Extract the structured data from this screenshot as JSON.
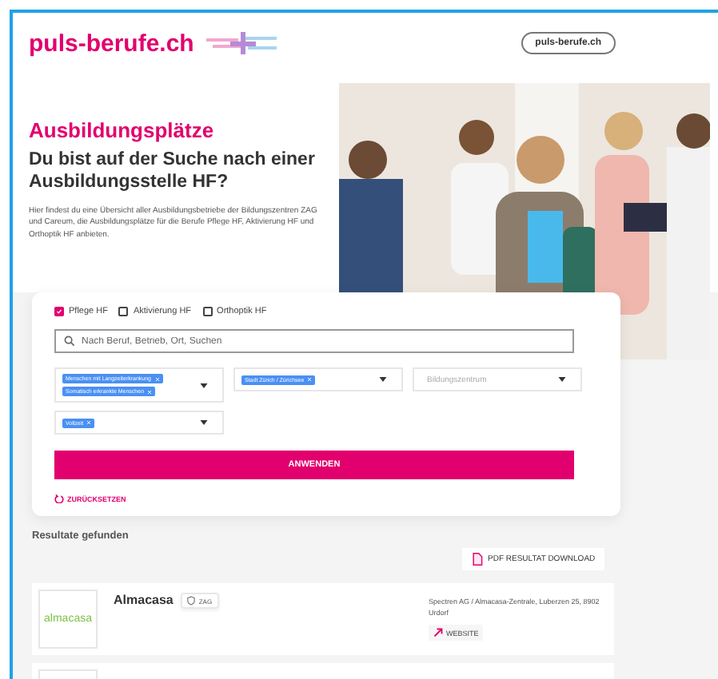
{
  "header": {
    "logo": "puls-berufe.ch",
    "link_button": "puls-berufe.ch"
  },
  "hero": {
    "title": "Ausbildungsplätze",
    "subtitle": "Du bist auf der Suche nach einer Ausbildungsstelle HF?",
    "description": "Hier findest du eine Übersicht aller Ausbildungsbetriebe der Bildungszentren ZAG und Careum, die Ausbildungsplätze für die Berufe Pflege HF, Aktivierung HF und Orthoptik HF anbieten."
  },
  "filters": {
    "checkboxes": [
      {
        "label": "Pflege HF",
        "checked": true
      },
      {
        "label": "Aktivierung HF",
        "checked": false
      },
      {
        "label": "Orthoptik HF",
        "checked": false
      }
    ],
    "search": {
      "placeholder": "Nach Beruf, Betrieb, Ort, Suchen"
    },
    "dropdowns": [
      {
        "tags": [
          "Menschen mit Langzeiterkrankung",
          "Somatisch erkrankte Menschen"
        ]
      },
      {
        "tags": [
          "Stadt Zürich / Zürichsee"
        ]
      },
      {
        "placeholder": "Bildungszentrum"
      },
      {
        "tags": [
          "Vollzeit"
        ]
      }
    ],
    "apply_button": "ANWENDEN",
    "reset_link": "ZURÜCKSETZEN"
  },
  "results": {
    "heading": "Resultate gefunden",
    "download_button": "PDF RESULTAT DOWNLOAD",
    "items": [
      {
        "logo_text": "almacasa",
        "name": "Almacasa",
        "badge": "ZAG",
        "address": "Spectren AG / Almacasa-Zentrale, Luberzen 25, 8902 Urdorf",
        "website_button": "WEBSITE"
      }
    ]
  }
}
